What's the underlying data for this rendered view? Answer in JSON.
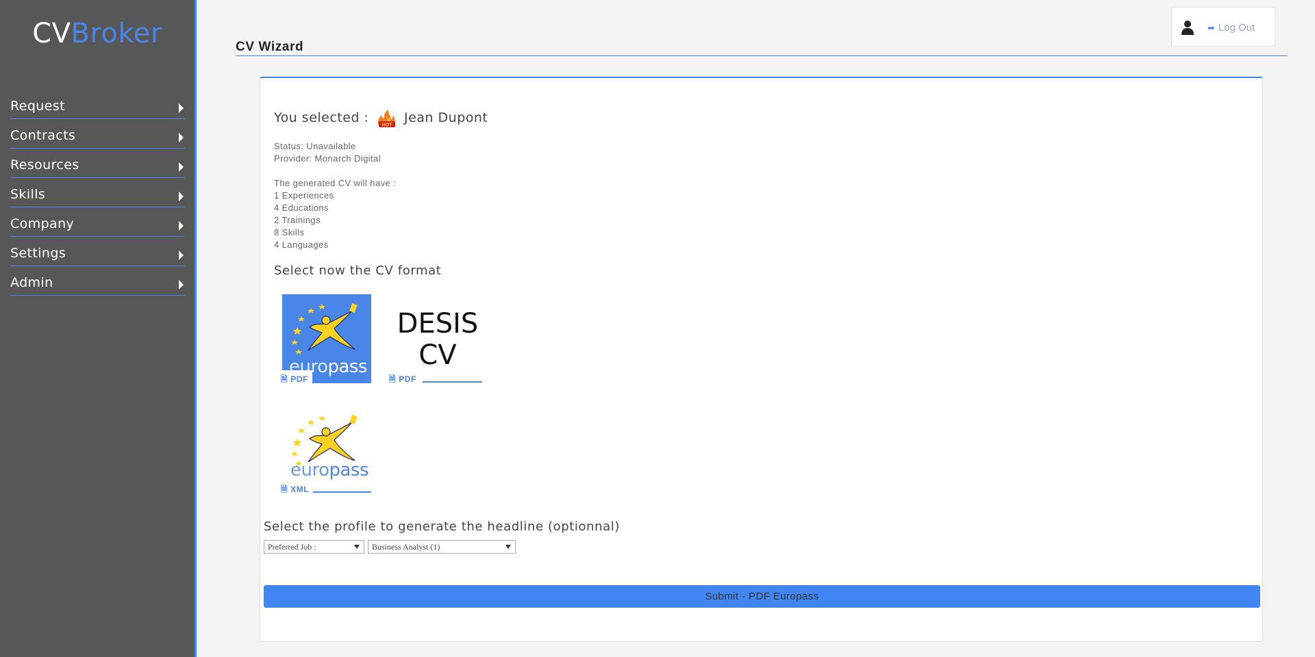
{
  "brand": {
    "part1": "CV",
    "part2": "Broker"
  },
  "sidebar": {
    "items": [
      {
        "label": "Request"
      },
      {
        "label": "Contracts"
      },
      {
        "label": "Resources"
      },
      {
        "label": "Skills"
      },
      {
        "label": "Company"
      },
      {
        "label": "Settings"
      },
      {
        "label": "Admin"
      }
    ]
  },
  "header": {
    "logout_label": "Log Out"
  },
  "page": {
    "title": "CV Wizard"
  },
  "selection": {
    "prefix": "You selected :",
    "name": "Jean Dupont",
    "badge": "HOT",
    "status": "Status: Unavailable",
    "provider": "Provider: Monarch Digital",
    "summary_intro": "The generated CV will have :",
    "counts": [
      "1 Experiences",
      "4 Educations",
      "2 Trainings",
      "8 Skills",
      "4 Languages"
    ]
  },
  "formats": {
    "heading": "Select now the CV format",
    "europass_pdf": {
      "logo_text_a": "euro",
      "logo_text_b": "pass",
      "label": "PDF"
    },
    "desis_pdf": {
      "line1": "DESIS",
      "line2": "CV",
      "label": "PDF"
    },
    "europass_xml": {
      "logo_text_a": "euro",
      "logo_text_b": "pass",
      "label": "XML"
    }
  },
  "profile": {
    "heading": "Select the profile to generate the headline (optionnal)",
    "select1_value": "Preferred Job :",
    "select2_value": "Business Analyst (1)"
  },
  "submit_label": "Submit - PDF Europass",
  "colors": {
    "accent": "#4285f4",
    "sidebar": "#575757"
  }
}
